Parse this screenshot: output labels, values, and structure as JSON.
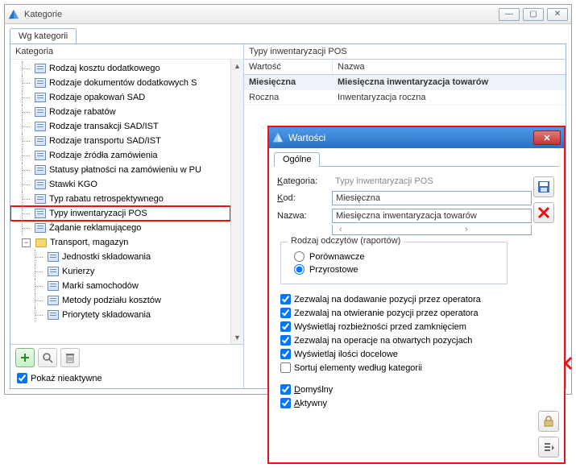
{
  "window": {
    "title": "Kategorie",
    "tab": "Wg kategorii"
  },
  "tree": {
    "header": "Kategoria",
    "items": [
      "Rodzaj kosztu dodatkowego",
      "Rodzaje dokumentów dodatkowych S",
      "Rodzaje opakowań SAD",
      "Rodzaje rabatów",
      "Rodzaje transakcji SAD/IST",
      "Rodzaje transportu SAD/IST",
      "Rodzaje źródła zamówienia",
      "Statusy płatności na zamówieniu w PU",
      "Stawki KGO",
      "Typ rabatu retrospektywnego",
      "Typy inwentaryzacji POS",
      "Żądanie reklamującego"
    ],
    "folder": "Transport, magazyn",
    "sub_items": [
      "Jednostki składowania",
      "Kurierzy",
      "Marki samochodów",
      "Metody podziału kosztów",
      "Priorytety składowania"
    ]
  },
  "left_footer": {
    "show_inactive": "Pokaż nieaktywne"
  },
  "grid": {
    "title": "Typy inwentaryzacji POS",
    "col1": "Wartość",
    "col2": "Nazwa",
    "rows": [
      {
        "v": "Miesięczna",
        "n": "Miesięczna inwentaryzacja towarów",
        "sel": true
      },
      {
        "v": "Roczna",
        "n": "Inwentaryzacja roczna",
        "sel": false
      }
    ]
  },
  "dialog": {
    "title": "Wartości",
    "tab": "Ogólne",
    "labels": {
      "kategoria": "Kategoria:",
      "kod": "Kod:",
      "nazwa": "Nazwa:"
    },
    "kategoria_value": "Typy inwentaryzacji POS",
    "kod_value": "Miesięczna",
    "nazwa_value": "Miesięczna inwentaryzacja towarów",
    "group_legend": "Rodzaj odczytów (raportów)",
    "radio1": "Porównawcze",
    "radio2": "Przyrostowe",
    "checks": [
      "Zezwalaj na dodawanie pozycji przez operatora",
      "Zezwalaj na otwieranie pozycji przez operatora",
      "Wyświetlaj rozbieżności przed zamknięciem",
      "Zezwalaj na operacje na otwartych pozycjach",
      "Wyświetlaj ilości docelowe",
      "Sortuj elementy według kategorii"
    ],
    "check_states": [
      true,
      true,
      true,
      true,
      true,
      false
    ],
    "footer_checks": {
      "default": "Domyślny",
      "active": "Aktywny"
    }
  }
}
